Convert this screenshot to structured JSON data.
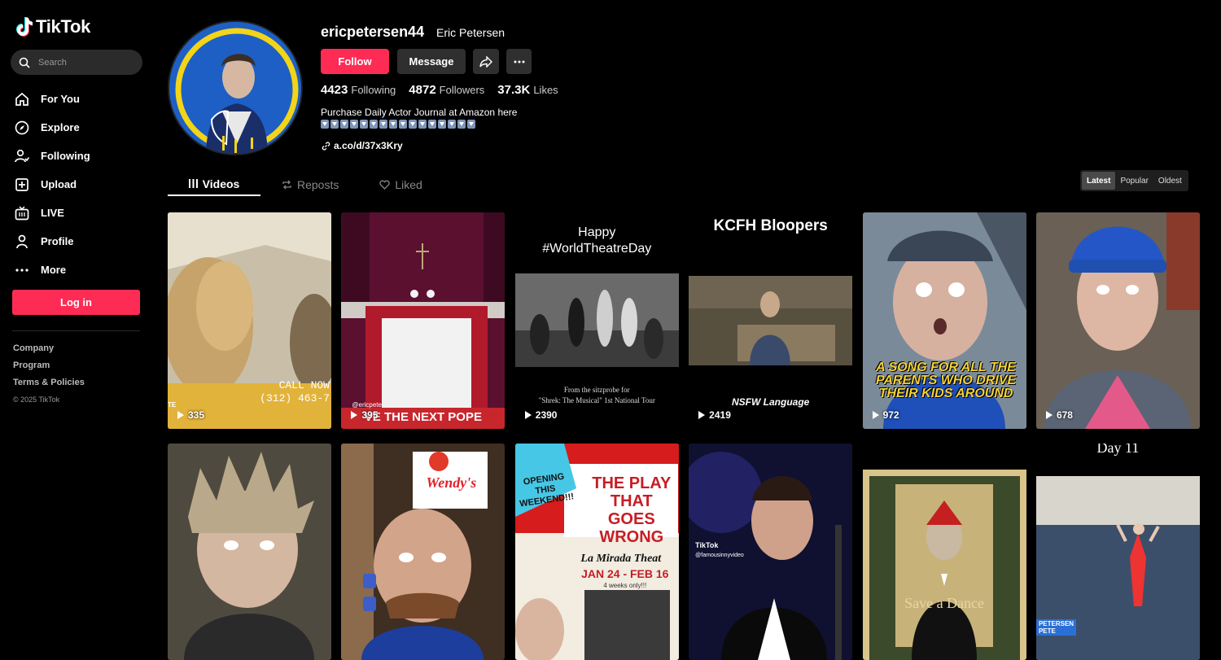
{
  "app": {
    "name": "TikTok"
  },
  "search": {
    "placeholder": "Search"
  },
  "nav": [
    {
      "label": "For You",
      "icon": "home-icon"
    },
    {
      "label": "Explore",
      "icon": "compass-icon"
    },
    {
      "label": "Following",
      "icon": "following-icon"
    },
    {
      "label": "Upload",
      "icon": "upload-icon"
    },
    {
      "label": "LIVE",
      "icon": "live-icon"
    },
    {
      "label": "Profile",
      "icon": "profile-icon"
    },
    {
      "label": "More",
      "icon": "more-dots-icon"
    }
  ],
  "login_label": "Log in",
  "footer": {
    "company": "Company",
    "program": "Program",
    "terms": "Terms & Policies",
    "copyright": "© 2025 TikTok"
  },
  "profile": {
    "username": "ericpetersen44",
    "display_name": "Eric Petersen",
    "follow_label": "Follow",
    "message_label": "Message",
    "following_count": "4423",
    "following_label": "Following",
    "followers_count": "4872",
    "followers_label": "Followers",
    "likes_count": "37.3K",
    "likes_label": "Likes",
    "bio": "Purchase Daily Actor Journal at Amazon here",
    "link": "a.co/d/37x3Kry"
  },
  "tabs": {
    "videos": "Videos",
    "reposts": "Reposts",
    "liked": "Liked"
  },
  "sort": {
    "latest": "Latest",
    "popular": "Popular",
    "oldest": "Oldest"
  },
  "videos": [
    {
      "views": "335",
      "overlay": "CALL NOW\n(312) 463-7",
      "tag": "TE"
    },
    {
      "views": "395",
      "overlay": "VE THE NEXT POPE",
      "tag": "@ericpete"
    },
    {
      "views": "2390",
      "title": "Happy\n#WorldTheatreDay",
      "caption": "From the sitzprobe for\n\"Shrek: The Musical\" 1st National Tour"
    },
    {
      "views": "2419",
      "title": "KCFH Bloopers",
      "caption": "NSFW Language"
    },
    {
      "views": "972",
      "overlay": "A SONG FOR ALL THE PARENTS WHO DRIVE THEIR KIDS AROUND"
    },
    {
      "views": "678"
    },
    {
      "views": ""
    },
    {
      "views": "",
      "overlay": "Wendy's"
    },
    {
      "views": "",
      "overlay": "OPENING THIS WEEKEND!!!",
      "title": "THE PLAY THAT GOES WRONG",
      "caption": "La Mirada Theat",
      "dates": "JAN 24 - FEB 16",
      "note": "4 weeks only!!!"
    },
    {
      "views": "",
      "tag": "TikTok",
      "handle": "@famousinnyvideo"
    },
    {
      "views": "",
      "overlay": "Save a Dance"
    },
    {
      "views": "",
      "title": "Day 11",
      "tag": "PETERSEN\nPETE"
    }
  ],
  "colors": {
    "accent": "#fe2c55",
    "background": "#000000",
    "button": "#2f2f2f"
  }
}
